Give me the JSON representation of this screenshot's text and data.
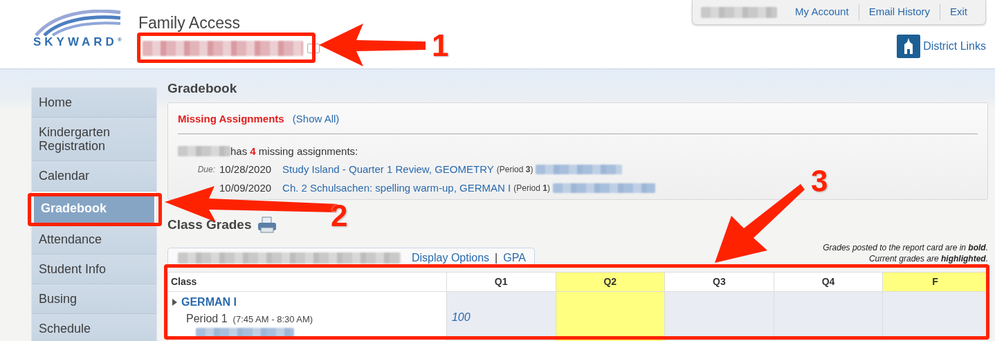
{
  "header": {
    "logo": "SKYWARD$^{®}$",
    "app_title": "Family Access",
    "account_links": [
      {
        "label": "My Account"
      },
      {
        "label": "Email History"
      },
      {
        "label": "Exit"
      }
    ],
    "district_links": "District Links"
  },
  "sidebar": {
    "items": [
      {
        "label": "Home",
        "selected": false
      },
      {
        "label": "Kindergarten Registration",
        "selected": false
      },
      {
        "label": "Calendar",
        "selected": false
      },
      {
        "label": "Gradebook",
        "selected": true
      },
      {
        "label": "Attendance",
        "selected": false
      },
      {
        "label": "Student Info",
        "selected": false
      },
      {
        "label": "Busing",
        "selected": false
      },
      {
        "label": "Schedule",
        "selected": false
      }
    ]
  },
  "page_title": "Gradebook",
  "missing": {
    "title": "Missing Assignments",
    "show_all": "(Show All)",
    "summary": "has **4** missing assignments:",
    "due_label": "Due:",
    "items": [
      {
        "date": "10/28/2020",
        "title": "Study Island - Quarter 1 Review, GEOMETRY",
        "period": "(Period **3**)"
      },
      {
        "date": "10/09/2020",
        "title": "Ch. 2 Schulsachen: spelling warm-up, GERMAN I",
        "period": "(Period **1**)"
      }
    ]
  },
  "class_grades": {
    "title": "Class Grades",
    "legend": [
      "Grades posted to the report card are in **bold**.",
      "Current grades are **highlighted**."
    ],
    "tabs": [
      {
        "label": "Display Options"
      },
      {
        "label": "GPA"
      }
    ],
    "tab_separator": "|"
  },
  "table": {
    "columns": [
      {
        "label": "Class",
        "highlighted": false
      },
      {
        "label": "Q1",
        "highlighted": false
      },
      {
        "label": "Q2",
        "highlighted": true
      },
      {
        "label": "Q3",
        "highlighted": false
      },
      {
        "label": "Q4",
        "highlighted": false
      },
      {
        "label": "F",
        "highlighted": true
      }
    ],
    "rows": [
      {
        "class": "GERMAN I",
        "period": "Period 1",
        "time": "(7:45 AM - 8:30 AM)",
        "expanded": false,
        "grades": [
          {
            "value": "100",
            "highlighted": false
          },
          {
            "highlighted": true
          },
          {
            "highlighted": false
          },
          {
            "highlighted": false
          },
          {
            "highlighted": false
          }
        ]
      }
    ]
  },
  "annotations": [
    {
      "label": "1"
    },
    {
      "label": "2"
    },
    {
      "label": "3"
    }
  ]
}
